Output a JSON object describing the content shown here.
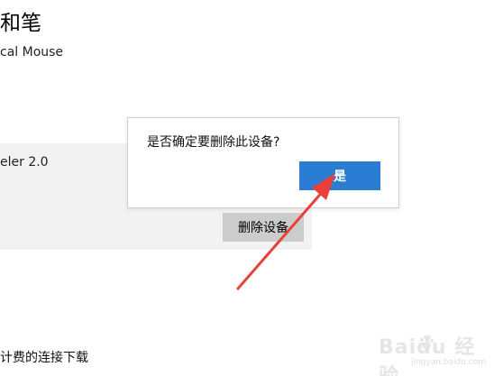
{
  "page": {
    "title_fragment": "和笔",
    "mouse_fragment": "cal Mouse",
    "device_fragment": "eler 2.0",
    "metered_fragment": "计费的连接下载"
  },
  "device_panel": {
    "remove_label": "删除设备"
  },
  "dialog": {
    "question": "是否确定要删除此设备?",
    "yes_label": "是"
  },
  "watermark": {
    "logo": "Baidu 经验",
    "url": "jingyan.baidu.com"
  },
  "colors": {
    "accent": "#2b7cd3",
    "arrow": "#e8413a",
    "panel": "#f2f2f2",
    "button_gray": "#cccccc"
  }
}
